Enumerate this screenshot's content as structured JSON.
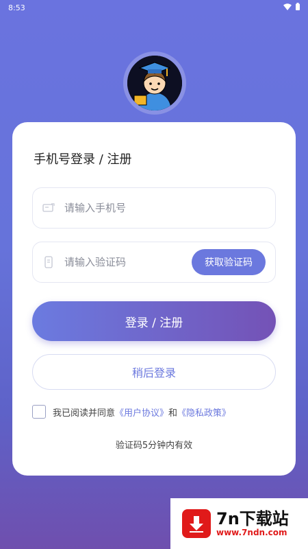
{
  "status_bar": {
    "time": "8:53"
  },
  "card": {
    "title": "手机号登录 / 注册",
    "phone_placeholder": "请输入手机号",
    "code_placeholder": "请输入验证码",
    "get_code_label": "获取验证码",
    "login_label": "登录 / 注册",
    "later_label": "稍后登录",
    "agree_prefix": "我已阅读并同意",
    "user_agreement": "《用户协议》",
    "and": "和",
    "privacy_policy": "《隐私政策》",
    "hint": "验证码5分钟内有效"
  },
  "watermark": {
    "title": "7n下载站",
    "url": "www.7ndn.com"
  },
  "colors": {
    "accent": "#6b78de",
    "gradient_end": "#7452b6",
    "brand_red": "#e01a1a"
  }
}
